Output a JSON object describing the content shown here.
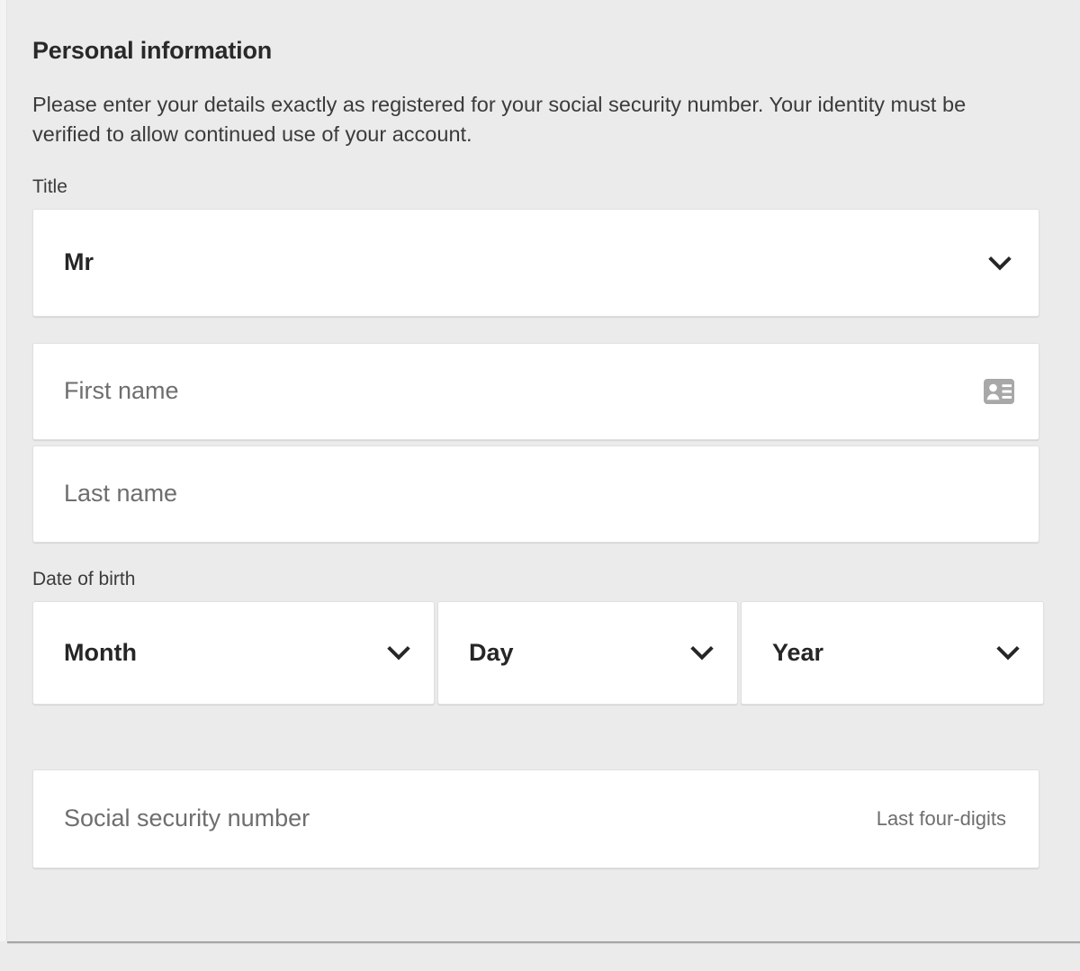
{
  "page": {
    "title": "Personal information",
    "intro": "Please enter your details exactly as registered for your social security number. Your identity must be verified to allow continued use of your account.",
    "background_color": "#ebebeb",
    "card_color": "#ffffff",
    "text_color": "#292929",
    "placeholder_color": "#6e6e6e"
  },
  "title_field": {
    "label": "Title",
    "value": "Mr",
    "chevron_icon": "chevron-down-icon"
  },
  "name_fields": {
    "first_name": {
      "placeholder": "First name",
      "value": "",
      "icon": "contact-card-icon"
    },
    "last_name": {
      "placeholder": "Last name",
      "value": ""
    }
  },
  "date_of_birth": {
    "label": "Date of birth",
    "month": {
      "value": "Month",
      "chevron_icon": "chevron-down-icon"
    },
    "day": {
      "value": "Day",
      "chevron_icon": "chevron-down-icon"
    },
    "year": {
      "value": "Year",
      "chevron_icon": "chevron-down-icon"
    }
  },
  "ssn_field": {
    "placeholder": "Social security number",
    "value": "",
    "hint": "Last four-digits"
  }
}
